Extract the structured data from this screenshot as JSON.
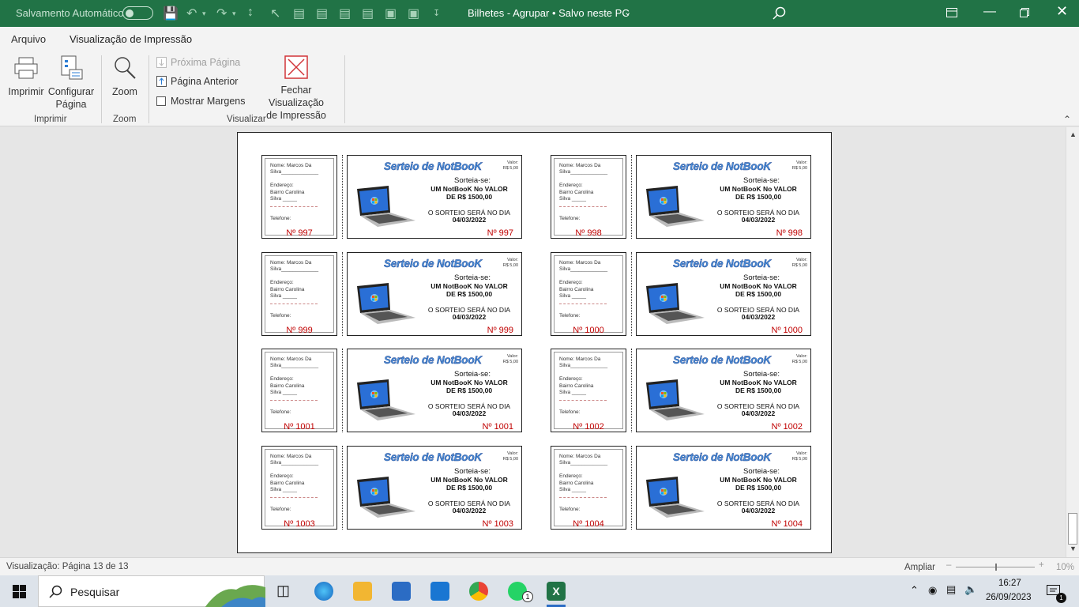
{
  "titlebar": {
    "autosave_label": "Salvamento Automático",
    "doc_title": "Bilhetes - Agrupar • Salvo neste PC",
    "accent": "#217346"
  },
  "tabs": [
    {
      "label": "Arquivo"
    },
    {
      "label": "Visualização de Impressão"
    }
  ],
  "ribbon": {
    "print_label": "Imprimir",
    "page_setup_label_1": "Configurar",
    "page_setup_label_2": "Página",
    "zoom_label": "Zoom",
    "next_page_label": "Próxima Página",
    "prev_page_label": "Página Anterior",
    "show_margins_label": "Mostrar Margens",
    "close_preview_label_1": "Fechar Visualização",
    "close_preview_label_2": "de Impressão",
    "group_print": "Imprimir",
    "group_zoom": "Zoom",
    "group_view": "Visualizar"
  },
  "ticket": {
    "stub_name": "Nome: Marcos Da",
    "stub_name2": "Silva_____________",
    "stub_address": "Endereço:",
    "stub_address2": "Bairro Carolina",
    "stub_address3": "Silva _____",
    "stub_phone": "Telefone:",
    "title": "Serteio de NotBooK",
    "valor_label": "Valor:",
    "valor_value": "R$ 5,00",
    "sortear": "Sorteia-se:",
    "prize_1": "UM NotBooK No VALOR",
    "prize_2": "DE R$ 1500,00",
    "draw_1": "O SORTEIO SERÁ NO DIA",
    "draw_2": "04/03/2022"
  },
  "tickets": [
    {
      "number": "Nº 997"
    },
    {
      "number": "Nº 998"
    },
    {
      "number": "Nº 999"
    },
    {
      "number": "Nº 1000"
    },
    {
      "number": "Nº 1001"
    },
    {
      "number": "Nº 1002"
    },
    {
      "number": "Nº 1003"
    },
    {
      "number": "Nº 1004"
    }
  ],
  "status": {
    "page_info": "Visualização: Página 13 de 13",
    "zoom_label": "Ampliar",
    "zoom_value": "10%"
  },
  "taskbar": {
    "search_placeholder": "Pesquisar",
    "time": "16:27",
    "date": "26/09/2023",
    "whatsapp_badge": "1",
    "notif_badge": "1"
  }
}
